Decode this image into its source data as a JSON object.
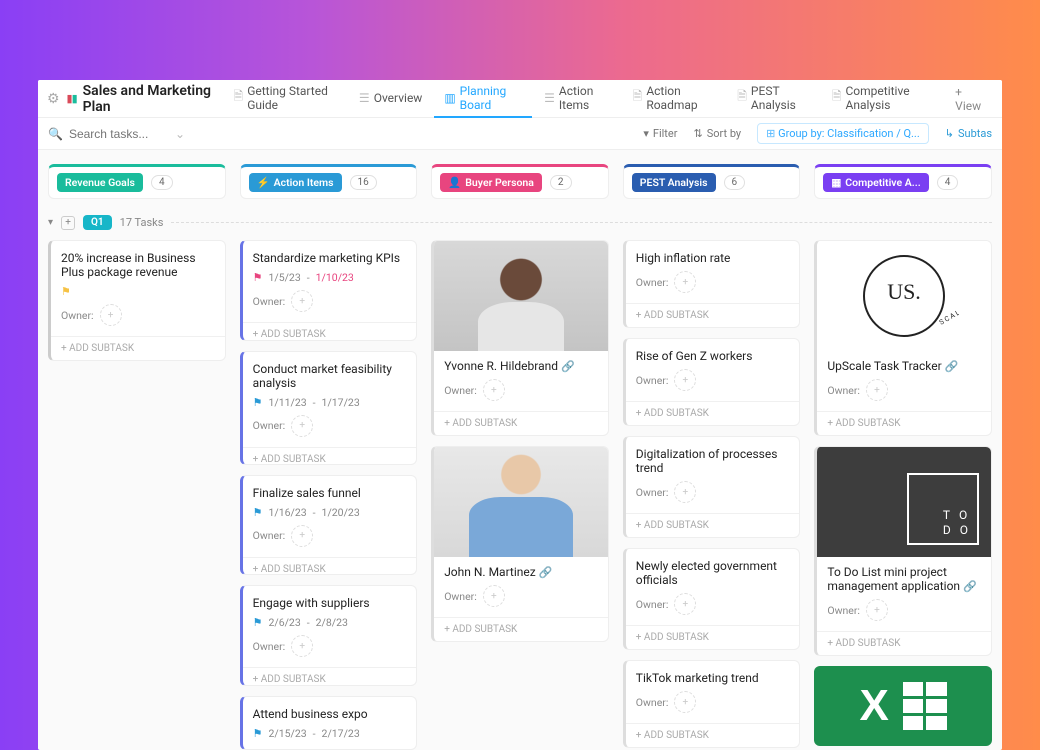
{
  "header": {
    "title": "Sales and Marketing Plan",
    "tabs": [
      {
        "label": "Getting Started Guide"
      },
      {
        "label": "Overview"
      },
      {
        "label": "Planning Board",
        "active": true
      },
      {
        "label": "Action Items"
      },
      {
        "label": "Action Roadmap"
      },
      {
        "label": "PEST Analysis"
      },
      {
        "label": "Competitive Analysis"
      }
    ],
    "add_view": "+ View"
  },
  "toolbar": {
    "search_placeholder": "Search tasks...",
    "filter": "Filter",
    "sort": "Sort by",
    "group_by": "Group by: Classification / Q...",
    "subtasks": "Subtas"
  },
  "columns": [
    {
      "label": "Revenue Goals",
      "count": "4"
    },
    {
      "label": "Action Items",
      "count": "16"
    },
    {
      "label": "Buyer Persona",
      "count": "2"
    },
    {
      "label": "PEST Analysis",
      "count": "6"
    },
    {
      "label": "Competitive A...",
      "count": "4"
    }
  ],
  "group": {
    "name": "Q1",
    "tasks": "17 Tasks"
  },
  "labels": {
    "owner": "Owner:",
    "add_subtask": "+ ADD SUBTASK"
  },
  "col1": [
    {
      "title": "20% increase in Business Plus package revenue",
      "flag_color": "#f6c244"
    }
  ],
  "col2": [
    {
      "title": "Standardize marketing KPIs",
      "flag_color": "#e8457f",
      "d1": "1/5/23",
      "d2": "1/10/23"
    },
    {
      "title": "Conduct market feasibility analysis",
      "flag_color": "#2a9ad6",
      "d1": "1/11/23",
      "d2": "1/17/23"
    },
    {
      "title": "Finalize sales funnel",
      "flag_color": "#2a9ad6",
      "d1": "1/16/23",
      "d2": "1/20/23"
    },
    {
      "title": "Engage with suppliers",
      "flag_color": "#2a9ad6",
      "d1": "2/6/23",
      "d2": "2/8/23"
    },
    {
      "title": "Attend business expo",
      "flag_color": "#2a9ad6",
      "d1": "2/15/23",
      "d2": "2/17/23"
    }
  ],
  "col3": [
    {
      "title": "Yvonne R. Hildebrand"
    },
    {
      "title": "John N. Martinez"
    }
  ],
  "col4": [
    {
      "title": "High inflation rate"
    },
    {
      "title": "Rise of Gen Z workers"
    },
    {
      "title": "Digitalization of processes trend"
    },
    {
      "title": "Newly elected government officials"
    },
    {
      "title": "TikTok marketing trend"
    }
  ],
  "col5": [
    {
      "title": "UpScale Task Tracker"
    },
    {
      "title": "To Do List mini project management application"
    }
  ]
}
